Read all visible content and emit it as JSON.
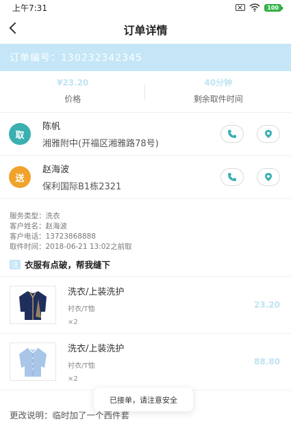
{
  "status_bar": {
    "time": "上午7:31",
    "battery": "100"
  },
  "nav": {
    "title": "订单详情"
  },
  "order": {
    "number": "订单编号：130232342345"
  },
  "stats": {
    "price_value": "¥23.20",
    "price_label": "价格",
    "time_value": "40分钟",
    "time_label": "剩余取件时间"
  },
  "pickup": {
    "badge": "取",
    "name": "陈帆",
    "address": "湘雅附中(开福区湘雅路78号)"
  },
  "delivery": {
    "badge": "送",
    "name": "赵海波",
    "address": "保利国际B1栋2321"
  },
  "service_info": [
    "服务类型：洗衣",
    "客户姓名：赵海波",
    "客户电话：13723868888",
    "取件时间：2018-06-21 13:02之前取"
  ],
  "note": {
    "tag": "注",
    "text": "衣服有点破，帮我缝下"
  },
  "items": [
    {
      "name": "洗衣/上装洗护",
      "category": "衬衣/T恤",
      "qty": "×2",
      "price": "23.20",
      "image": "navy-jacket-image"
    },
    {
      "name": "洗衣/上装洗护",
      "category": "衬衣/T恤",
      "qty": "×2",
      "price": "88.80",
      "image": "light-blue-shirt-image"
    }
  ],
  "remark": "更改说明：临时加了一个西件套",
  "toast": "已接单，请注意安全",
  "colors": {
    "accent": "#c4e6f7",
    "pickup_badge": "#3ab0b0",
    "delivery_badge": "#f0a32a",
    "icon": "#3ab0b0"
  }
}
